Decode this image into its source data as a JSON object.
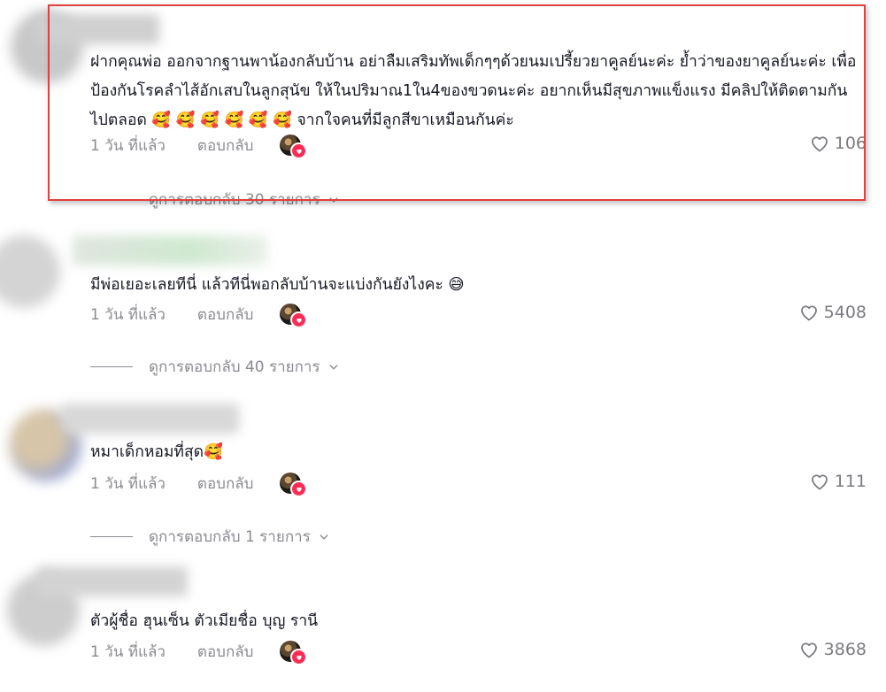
{
  "comments": [
    {
      "text": "ฝากคุณพ่อ ออกจากฐานพาน้องกลับบ้าน อย่าลืมเสริมทัพเด็กๆๆด้วยนมเปรี้ยวยาคูลย์นะค่ะ ย้ำว่าของยาคูลย์นะค่ะ เพื่อป้องกันโรคลำไส้อักเสบในลูกสุนัข ให้ในปริมาณ1ใน4ของขวดนะค่ะ อยากเห็นมีสุขภาพแข็งแรง มีคลิปให้ติดตามกันไปตลอด 🥰 🥰 🥰 🥰 🥰 🥰 จากใจคนที่มีลูกสีขาเหมือนกันค่ะ",
      "time": "1 วัน ที่แล้ว",
      "reply": "ตอบกลับ",
      "likes": "106",
      "view_replies": "ดูการตอบกลับ 30 รายการ"
    },
    {
      "text": "มีพ่อเยอะเลยทีนี่ แล้วทีนี่พอกลับบ้านจะแบ่งกันยังไงคะ 😅",
      "time": "1 วัน ที่แล้ว",
      "reply": "ตอบกลับ",
      "likes": "5408",
      "view_replies": "ดูการตอบกลับ 40 รายการ"
    },
    {
      "text": "หมาเด็กหอมที่สุด🥰",
      "time": "1 วัน ที่แล้ว",
      "reply": "ตอบกลับ",
      "likes": "111",
      "view_replies": "ดูการตอบกลับ 1 รายการ"
    },
    {
      "text": "ตัวผู้ชื่อ ฮุนเซ็น ตัวเมียชื่อ บุญ รานี",
      "time": "1 วัน ที่แล้ว",
      "reply": "ตอบกลับ",
      "likes": "3868"
    }
  ],
  "icons": {
    "like": "heart-outline-icon",
    "creator_liked": "creator-liked-badge-icon",
    "expand": "chevron-down-icon"
  },
  "colors": {
    "highlight_border": "#e0403f",
    "creator_heart": "#fe2c55",
    "muted_text": "#8a8b91"
  }
}
